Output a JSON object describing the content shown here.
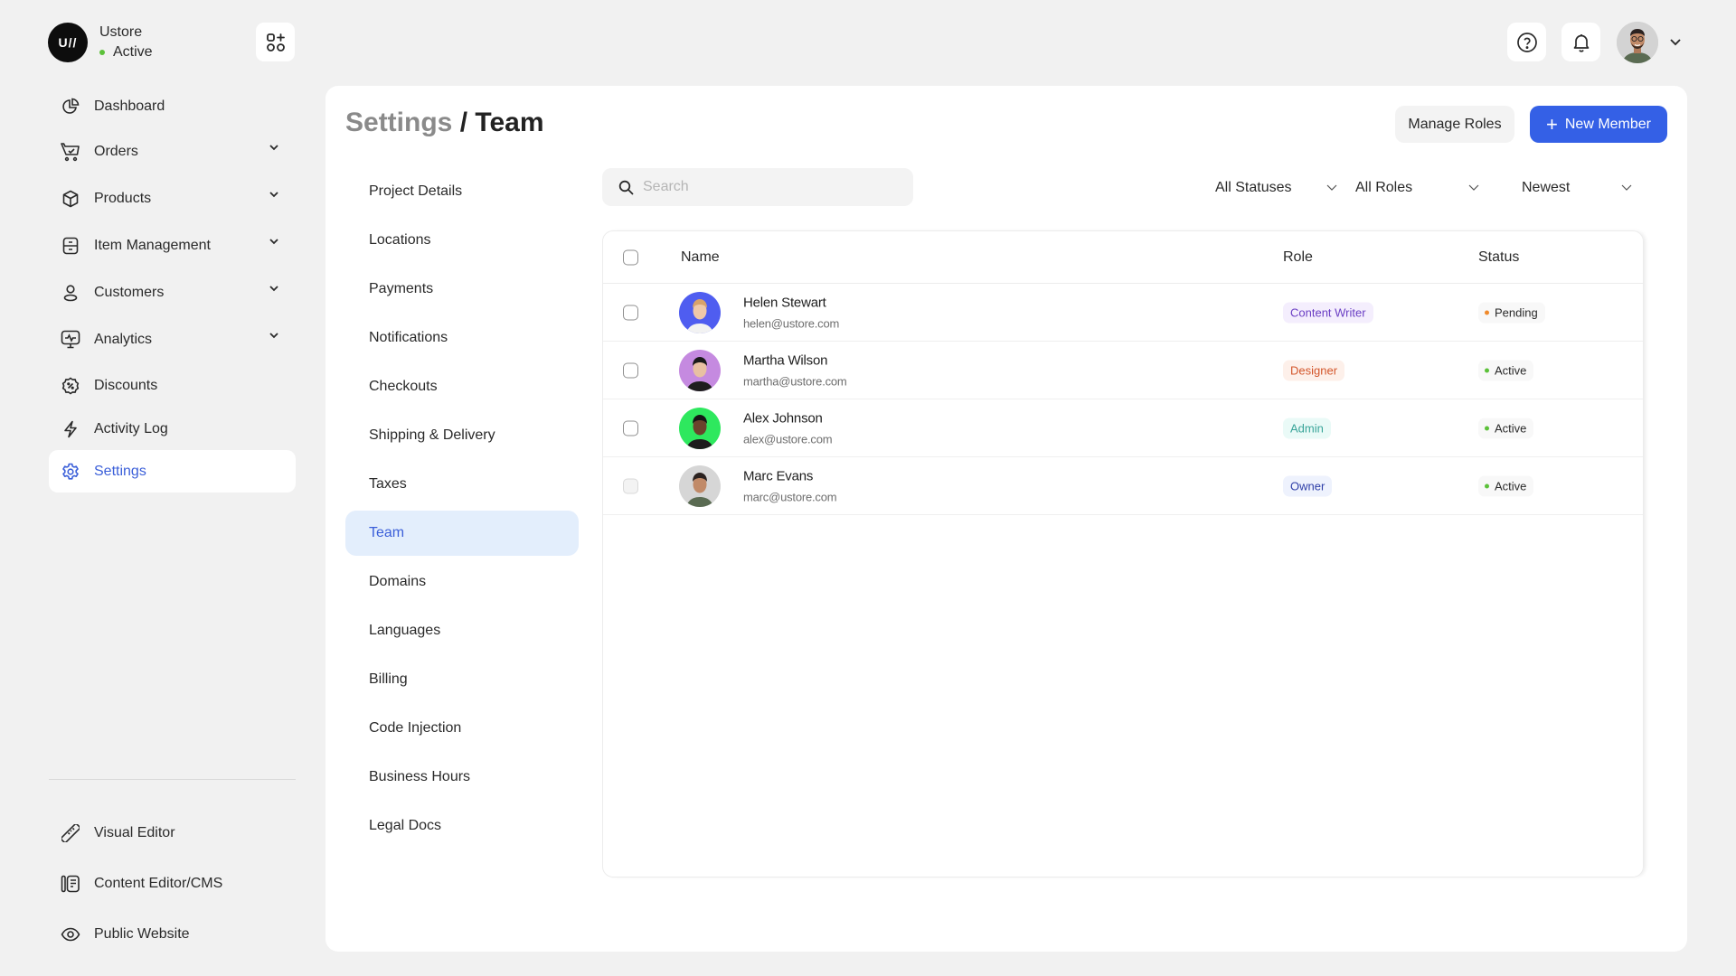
{
  "brand": {
    "logo_text": "U//",
    "name": "Ustore",
    "status": "Active",
    "status_color": "#5cc13a"
  },
  "sidebar": {
    "items": [
      {
        "label": "Dashboard",
        "icon": "pie-chart-icon",
        "expandable": false
      },
      {
        "label": "Orders",
        "icon": "shopping-cart-icon",
        "expandable": true
      },
      {
        "label": "Products",
        "icon": "box-icon",
        "expandable": true
      },
      {
        "label": "Item Management",
        "icon": "inventory-icon",
        "expandable": true
      },
      {
        "label": "Customers",
        "icon": "user-icon",
        "expandable": true
      },
      {
        "label": "Analytics",
        "icon": "monitor-chart-icon",
        "expandable": true
      },
      {
        "label": "Discounts",
        "icon": "discount-badge-icon",
        "expandable": false
      },
      {
        "label": "Activity Log",
        "icon": "lightning-icon",
        "expandable": false
      },
      {
        "label": "Settings",
        "icon": "gear-icon",
        "expandable": false,
        "active": true
      }
    ],
    "bottom_items": [
      {
        "label": "Visual Editor",
        "icon": "ruler-icon"
      },
      {
        "label": "Content Editor/CMS",
        "icon": "document-edit-icon"
      },
      {
        "label": "Public Website",
        "icon": "eye-icon"
      }
    ]
  },
  "topbar": {
    "help_icon": "help-circle-icon",
    "notification_icon": "bell-icon",
    "user_avatar": "user-avatar"
  },
  "page": {
    "breadcrumb_parent": "Settings",
    "separator": "/",
    "title": "Team",
    "manage_roles_label": "Manage Roles",
    "new_member_label": "New Member"
  },
  "settings_menu": {
    "items": [
      "Project Details",
      "Locations",
      "Payments",
      "Notifications",
      "Checkouts",
      "Shipping & Delivery",
      "Taxes",
      "Team",
      "Domains",
      "Languages",
      "Billing",
      "Code Injection",
      "Business Hours",
      "Legal Docs"
    ],
    "active": "Team"
  },
  "search": {
    "placeholder": "Search",
    "value": ""
  },
  "filters": {
    "status": "All Statuses",
    "role": "All Roles",
    "sort": "Newest"
  },
  "table": {
    "columns": {
      "name": "Name",
      "role": "Role",
      "status": "Status"
    },
    "rows": [
      {
        "name": "Helen Stewart",
        "email": "helen@ustore.com",
        "role": "Content Writer",
        "role_color": "#6b3fc4",
        "role_bg": "#f4eefd",
        "status": "Pending",
        "status_color": "#f08a2c",
        "avatar_bg": "#4f5df0",
        "checkbox_disabled": false
      },
      {
        "name": "Martha Wilson",
        "email": "martha@ustore.com",
        "role": "Designer",
        "role_color": "#d3562b",
        "role_bg": "#fdf0ea",
        "status": "Active",
        "status_color": "#5cc13a",
        "avatar_bg": "#c58ae0",
        "checkbox_disabled": false
      },
      {
        "name": "Alex Johnson",
        "email": "alex@ustore.com",
        "role": "Admin",
        "role_color": "#3aa59a",
        "role_bg": "#eafaf7",
        "status": "Active",
        "status_color": "#5cc13a",
        "avatar_bg": "#2ee85e",
        "checkbox_disabled": false
      },
      {
        "name": "Marc Evans",
        "email": "marc@ustore.com",
        "role": "Owner",
        "role_color": "#2f3fa8",
        "role_bg": "#eef2fd",
        "status": "Active",
        "status_color": "#5cc13a",
        "avatar_bg": "#d6d6d6",
        "checkbox_disabled": true
      }
    ]
  },
  "colors": {
    "accent": "#3460e6",
    "active_nav_text": "#3b5fd9",
    "active_submenu_bg": "#e3eefc",
    "background": "#f1f1f1"
  }
}
